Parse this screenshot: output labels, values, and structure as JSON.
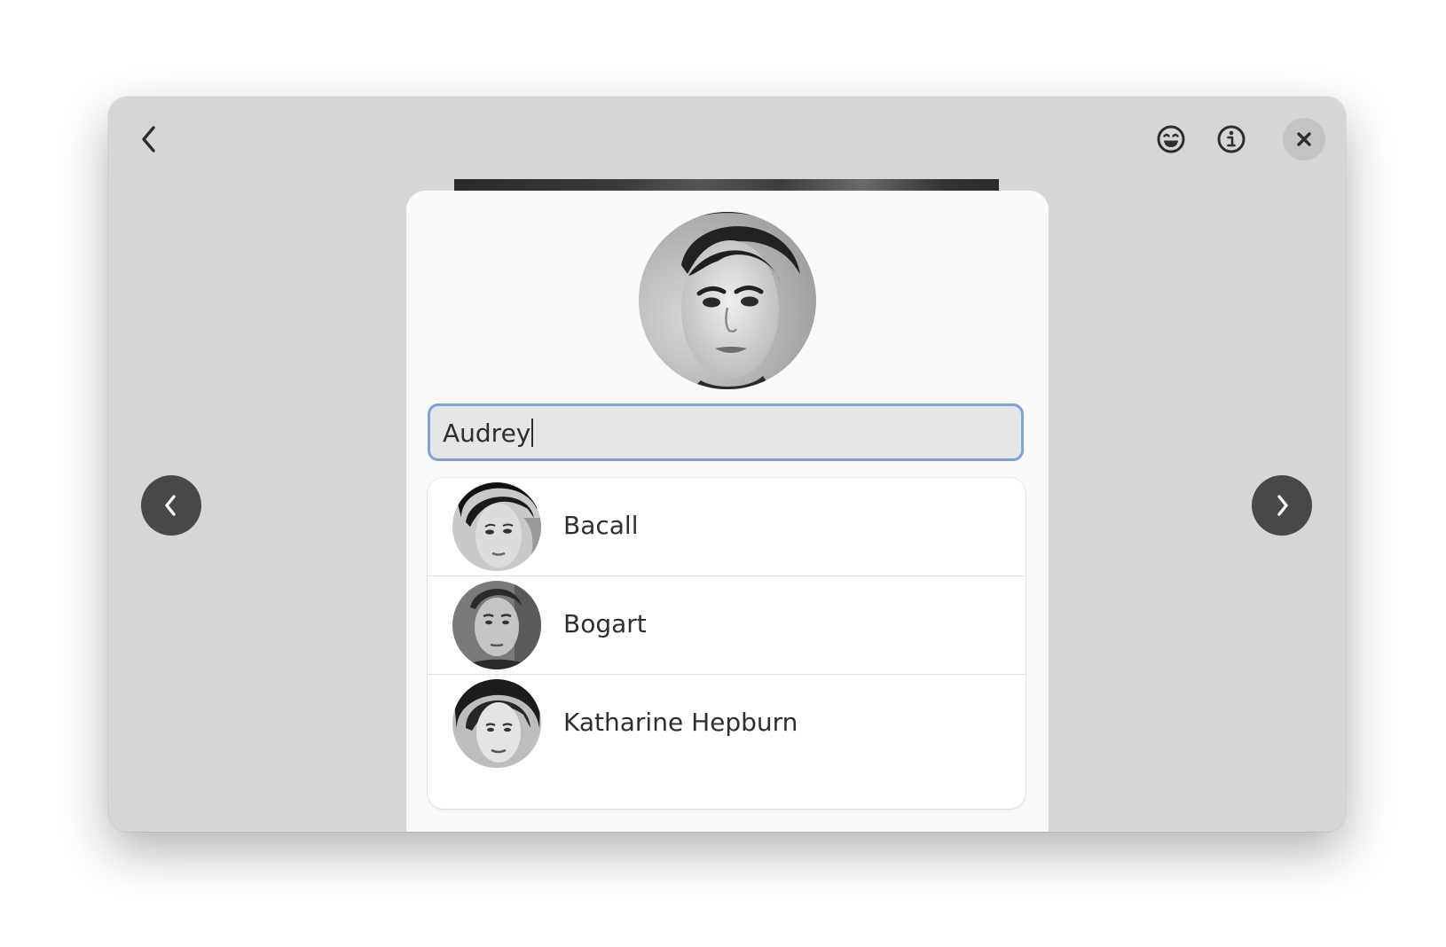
{
  "header": {
    "back_icon": "chevron-left-icon",
    "emoji_icon": "emoji-smile-icon",
    "info_icon": "info-icon",
    "close_icon": "close-icon"
  },
  "navigation": {
    "previous_icon": "chevron-left-icon",
    "next_icon": "chevron-right-icon"
  },
  "dialog": {
    "main_avatar_icon": "face-portrait",
    "name_entry": {
      "value": "Audrey"
    },
    "suggestions": [
      {
        "name": "Bacall"
      },
      {
        "name": "Bogart"
      },
      {
        "name": "Katharine Hepburn"
      }
    ]
  },
  "colors": {
    "window_bg": "#d6d6d6",
    "dialog_bg": "#fafafa",
    "entry_bg": "#e6e6e6",
    "focus_ring": "#7ba3dd",
    "nav_button_bg": "#484848",
    "text": "#2e2e2e"
  }
}
